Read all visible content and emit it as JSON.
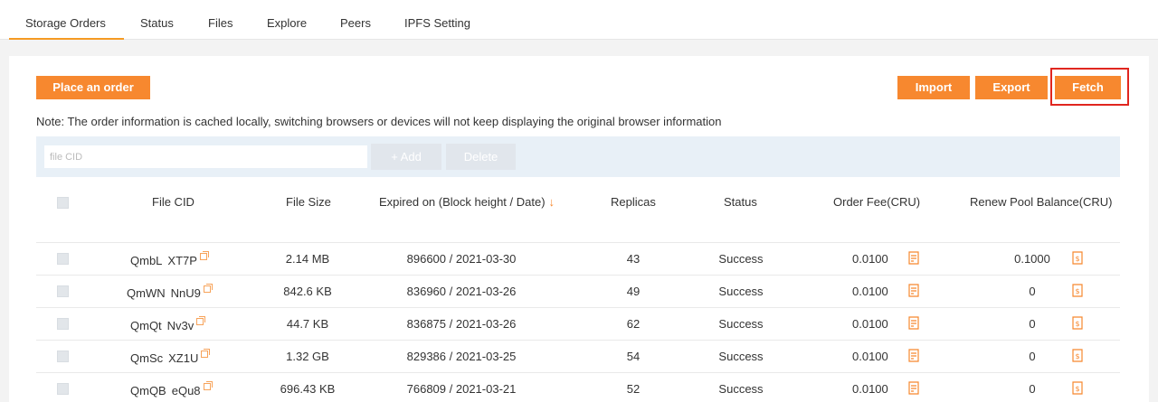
{
  "tabs": [
    {
      "label": "Storage Orders",
      "active": true
    },
    {
      "label": "Status"
    },
    {
      "label": "Files"
    },
    {
      "label": "Explore"
    },
    {
      "label": "Peers"
    },
    {
      "label": "IPFS Setting"
    }
  ],
  "actions": {
    "place_order": "Place an order",
    "import": "Import",
    "export": "Export",
    "fetch": "Fetch"
  },
  "note": "Note: The order information is cached locally, switching browsers or devices will not keep displaying the original browser information",
  "filter": {
    "cid_placeholder": "file CID",
    "add": "+ Add",
    "delete": "Delete"
  },
  "table": {
    "headers": {
      "file_cid": "File CID",
      "file_size": "File Size",
      "expired_on": "Expired on (Block height / Date)",
      "replicas": "Replicas",
      "status": "Status",
      "order_fee": "Order Fee(CRU)",
      "renew_pool": "Renew Pool Balance(CRU)"
    },
    "rows": [
      {
        "cid_start": "QmbL",
        "cid_end": "XT7P",
        "size": "2.14 MB",
        "expired": "896600 / 2021-03-30",
        "replicas": "43",
        "status": "Success",
        "fee": "0.0100",
        "renew": "0.1000"
      },
      {
        "cid_start": "QmWN",
        "cid_end": "NnU9",
        "size": "842.6 KB",
        "expired": "836960 / 2021-03-26",
        "replicas": "49",
        "status": "Success",
        "fee": "0.0100",
        "renew": "0"
      },
      {
        "cid_start": "QmQt",
        "cid_end": "Nv3v",
        "size": "44.7 KB",
        "expired": "836875 / 2021-03-26",
        "replicas": "62",
        "status": "Success",
        "fee": "0.0100",
        "renew": "0"
      },
      {
        "cid_start": "QmSc",
        "cid_end": "XZ1U",
        "size": "1.32 GB",
        "expired": "829386 / 2021-03-25",
        "replicas": "54",
        "status": "Success",
        "fee": "0.0100",
        "renew": "0"
      },
      {
        "cid_start": "QmQB",
        "cid_end": "eQu8",
        "size": "696.43 KB",
        "expired": "766809 / 2021-03-21",
        "replicas": "52",
        "status": "Success",
        "fee": "0.0100",
        "renew": "0"
      }
    ]
  },
  "colors": {
    "accent": "#f7882f",
    "highlight": "#e0261f"
  }
}
